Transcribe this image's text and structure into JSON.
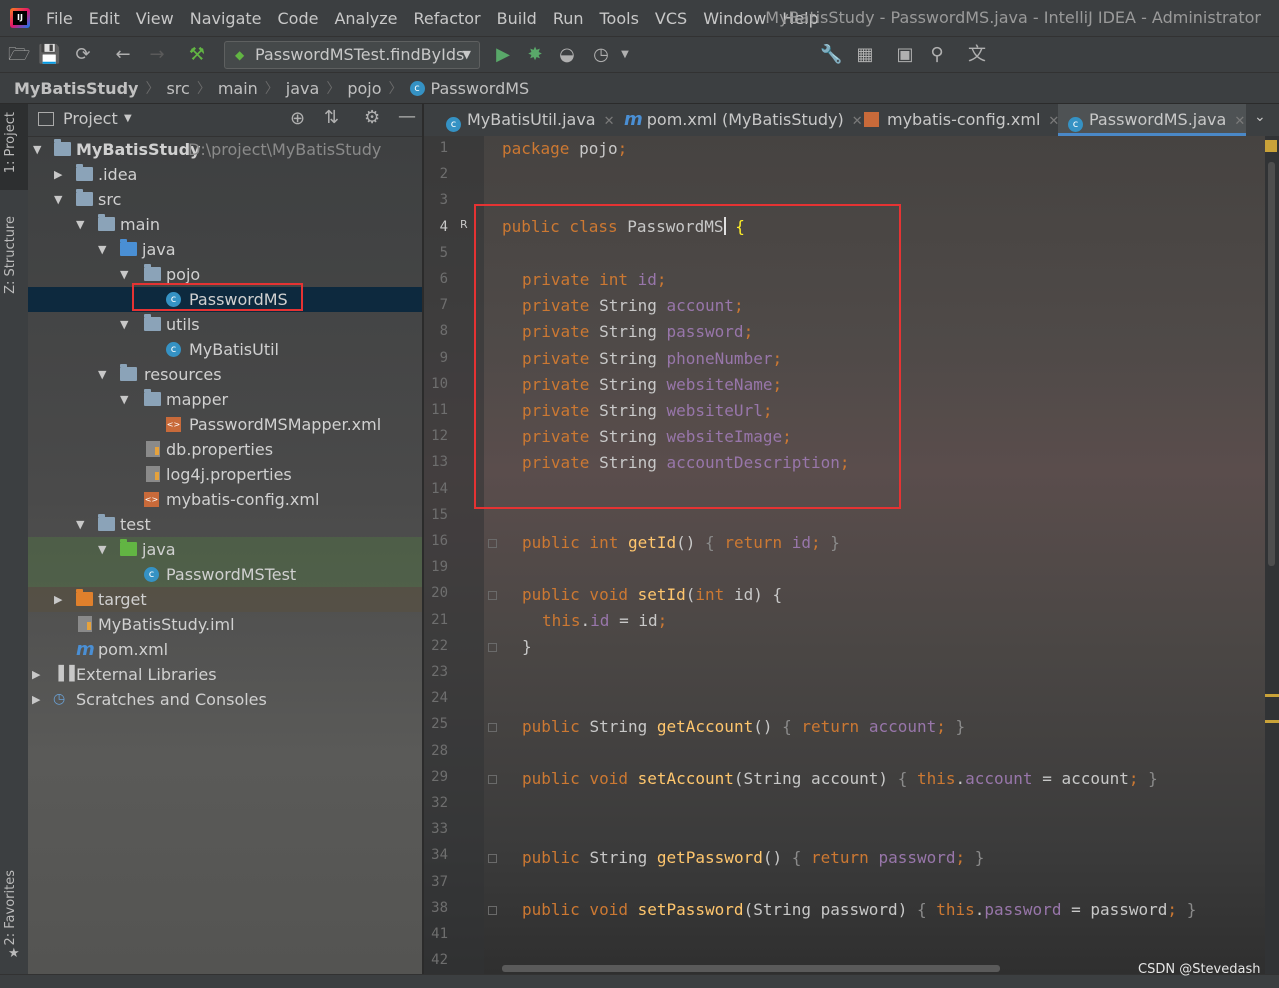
{
  "window": {
    "menu": [
      "File",
      "Edit",
      "View",
      "Navigate",
      "Code",
      "Analyze",
      "Refactor",
      "Build",
      "Run",
      "Tools",
      "VCS",
      "Window",
      "Help"
    ],
    "title": "MyBatisStudy - PasswordMS.java - IntelliJ IDEA - Administrator"
  },
  "toolbar": {
    "run_config": "PasswordMSTest.findByIds"
  },
  "breadcrumb": [
    "MyBatisStudy",
    "src",
    "main",
    "java",
    "pojo",
    "PasswordMS"
  ],
  "side_tabs": {
    "project": "1: Project",
    "structure": "Z: Structure",
    "favorites": "2: Favorites"
  },
  "project_panel": {
    "title": "Project",
    "root_name": "MyBatisStudy",
    "root_path": "D:\\project\\MyBatisStudy",
    "nodes": [
      ".idea",
      "src",
      "main",
      "java",
      "pojo",
      "PasswordMS",
      "utils",
      "MyBatisUtil",
      "resources",
      "mapper",
      "PasswordMSMapper.xml",
      "db.properties",
      "log4j.properties",
      "mybatis-config.xml",
      "test",
      "java",
      "PasswordMSTest",
      "target",
      "MyBatisStudy.iml",
      "pom.xml",
      "External Libraries",
      "Scratches and Consoles"
    ]
  },
  "editor_tabs": [
    {
      "label": "MyBatisUtil.java",
      "active": false
    },
    {
      "label": "pom.xml (MyBatisStudy)",
      "active": false
    },
    {
      "label": "mybatis-config.xml",
      "active": false
    },
    {
      "label": "PasswordMS.java",
      "active": true
    }
  ],
  "code": {
    "line_numbers": [
      "1",
      "2",
      "3",
      "4",
      "5",
      "6",
      "7",
      "8",
      "9",
      "10",
      "11",
      "12",
      "13",
      "14",
      "15",
      "16",
      "19",
      "20",
      "21",
      "22",
      "23",
      "24",
      "25",
      "28",
      "29",
      "32",
      "33",
      "34",
      "37",
      "38",
      "41",
      "42"
    ],
    "package_kw": "package",
    "package_name": " pojo",
    "class_kw": "public class",
    "class_name": " PasswordMS",
    "fields": [
      {
        "type": "int",
        "name": "id"
      },
      {
        "type": "String",
        "name": "account"
      },
      {
        "type": "String",
        "name": "password"
      },
      {
        "type": "String",
        "name": "phoneNumber"
      },
      {
        "type": "String",
        "name": "websiteName"
      },
      {
        "type": "String",
        "name": "websiteUrl"
      },
      {
        "type": "String",
        "name": "websiteImage"
      },
      {
        "type": "String",
        "name": "accountDescription"
      }
    ]
  },
  "watermark": "CSDN @Stevedash",
  "colors": {
    "keyword": "#cc7832",
    "field": "#9876aa",
    "method": "#ffc66d",
    "highlight": "#e53333",
    "selection": "#0d293e"
  }
}
